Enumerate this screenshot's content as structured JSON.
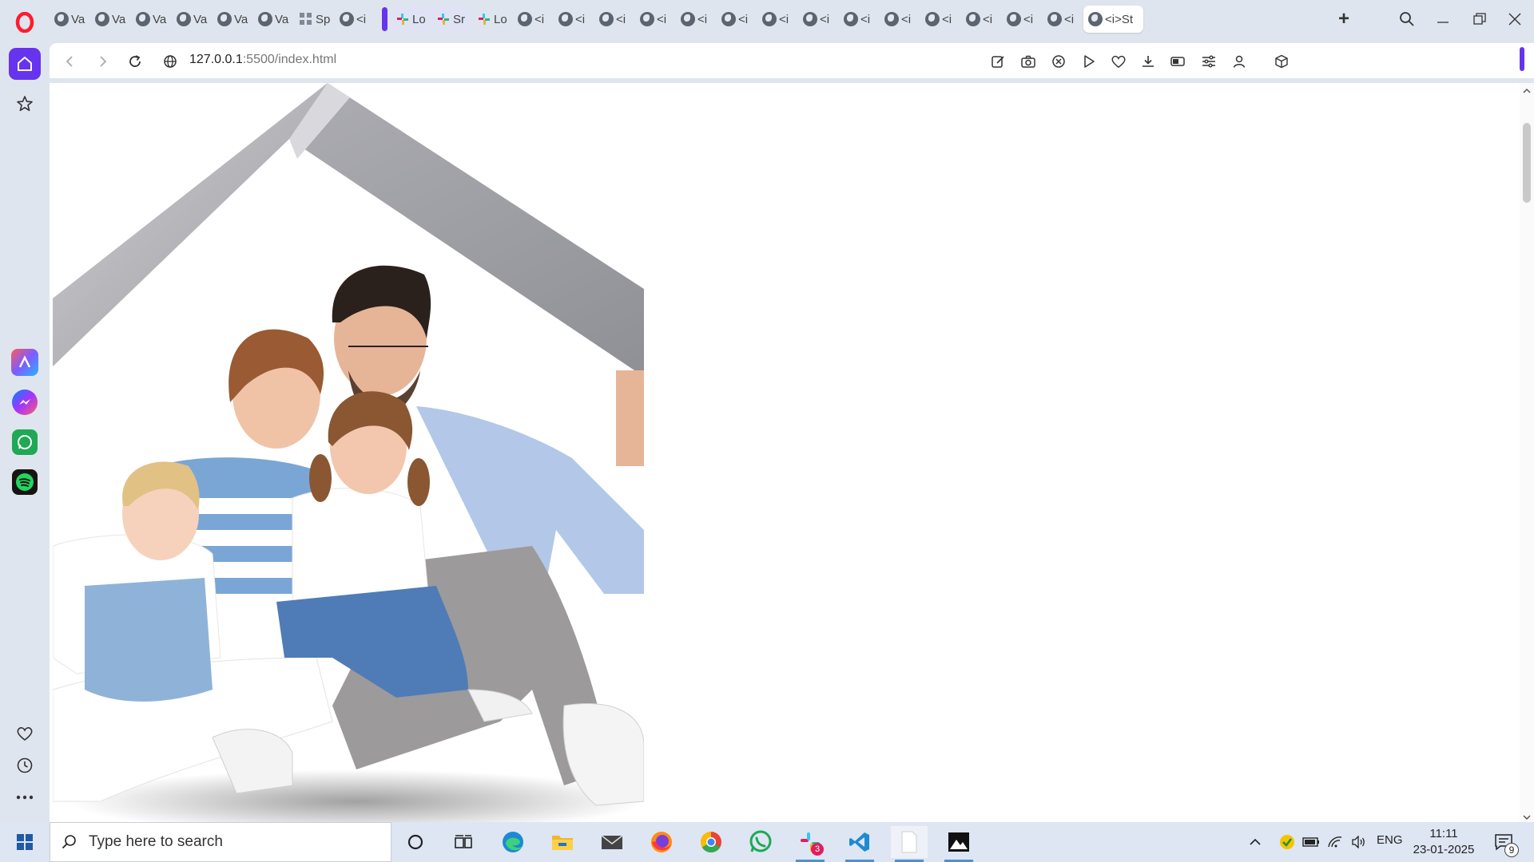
{
  "browser": {
    "tabs": [
      {
        "label": "Va",
        "icon": "globe-icon",
        "grouped": false
      },
      {
        "label": "Va",
        "icon": "globe-icon",
        "grouped": false
      },
      {
        "label": "Va",
        "icon": "globe-icon",
        "grouped": false
      },
      {
        "label": "Va",
        "icon": "globe-icon",
        "grouped": false
      },
      {
        "label": "Va",
        "icon": "globe-icon",
        "grouped": false
      },
      {
        "label": "Va",
        "icon": "globe-icon",
        "grouped": false
      },
      {
        "label": "Sp",
        "icon": "grid-icon",
        "grouped": false
      },
      {
        "label": "<i",
        "icon": "globe-icon",
        "grouped": false
      },
      {
        "label": "Lo",
        "icon": "slack-icon",
        "grouped": true
      },
      {
        "label": "Sr",
        "icon": "slack-icon",
        "grouped": true
      },
      {
        "label": "Lo",
        "icon": "slack-icon",
        "grouped": false
      },
      {
        "label": "<i",
        "icon": "globe-icon",
        "grouped": false
      },
      {
        "label": "<i",
        "icon": "globe-icon",
        "grouped": false
      },
      {
        "label": "<i",
        "icon": "globe-icon",
        "grouped": false
      },
      {
        "label": "<i",
        "icon": "globe-icon",
        "grouped": false
      },
      {
        "label": "<i",
        "icon": "globe-icon",
        "grouped": false
      },
      {
        "label": "<i",
        "icon": "globe-icon",
        "grouped": false
      },
      {
        "label": "<i",
        "icon": "globe-icon",
        "grouped": false
      },
      {
        "label": "<i",
        "icon": "globe-icon",
        "grouped": false
      },
      {
        "label": "<i",
        "icon": "globe-icon",
        "grouped": false
      },
      {
        "label": "<i",
        "icon": "globe-icon",
        "grouped": false
      },
      {
        "label": "<i",
        "icon": "globe-icon",
        "grouped": false
      },
      {
        "label": "<i",
        "icon": "globe-icon",
        "grouped": false
      },
      {
        "label": "<i",
        "icon": "globe-icon",
        "grouped": false
      },
      {
        "label": "<i",
        "icon": "globe-icon",
        "grouped": false
      },
      {
        "label": "<i>St",
        "icon": "globe-icon",
        "grouped": false,
        "active": true
      }
    ],
    "new_tab_label": "+",
    "address": {
      "host": "127.0.0.1",
      "rest": ":5500/index.html"
    },
    "accent_color": "#6633ee",
    "opera_red": "#ff1b2d"
  },
  "sidebar": {
    "items": [
      "home-icon",
      "star-icon",
      "aria-icon",
      "messenger-icon",
      "whatsapp-icon",
      "spotify-icon",
      "heart-icon",
      "history-icon",
      "more-icon"
    ]
  },
  "page": {
    "image": "family-under-roof-photo",
    "background": "#ffffff"
  },
  "taskbar": {
    "search_placeholder": "Type here to search",
    "slack_badge": "3",
    "language": "ENG",
    "time": "11:11",
    "date": "23-01-2025",
    "notification_count": "9"
  }
}
